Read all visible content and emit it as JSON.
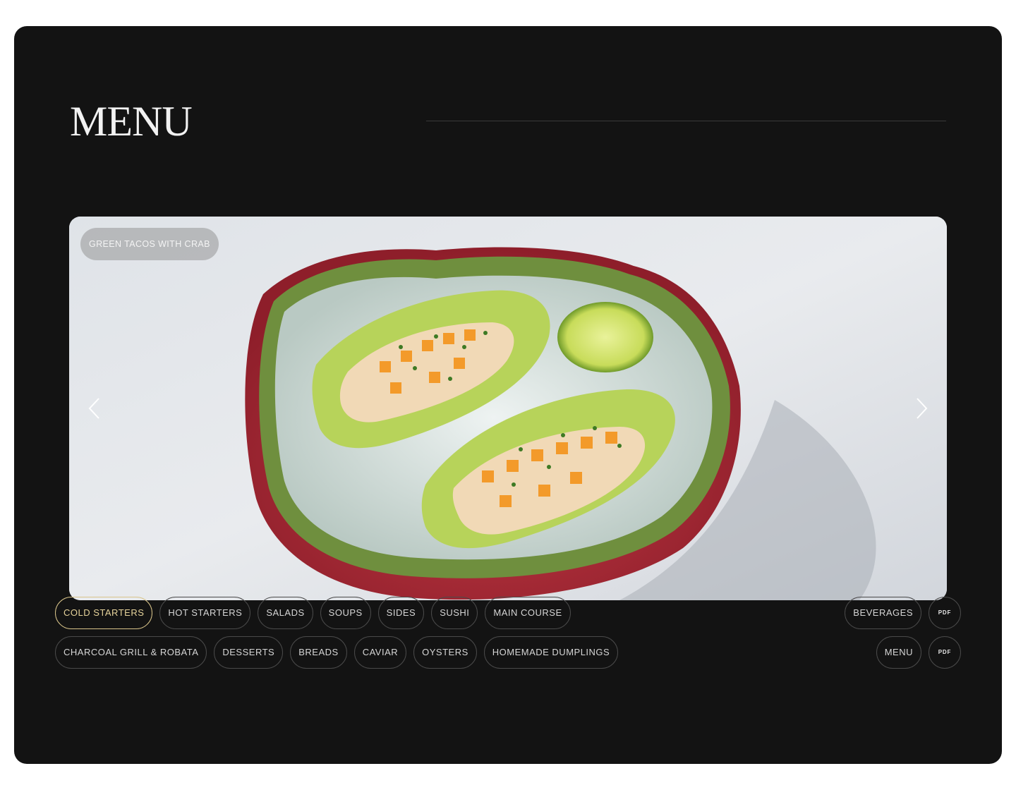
{
  "page": {
    "title": "MENU"
  },
  "hero": {
    "caption": "GREEN TACOS WITH CRAB",
    "prev_icon": "chevron-left-icon",
    "next_icon": "chevron-right-icon"
  },
  "categories": {
    "row1": [
      {
        "label": "COLD STARTERS",
        "active": true
      },
      {
        "label": "HOT STARTERS",
        "active": false
      },
      {
        "label": "SALADS",
        "active": false
      },
      {
        "label": "SOUPS",
        "active": false
      },
      {
        "label": "SIDES",
        "active": false
      },
      {
        "label": "SUSHI",
        "active": false
      },
      {
        "label": "MAIN COURSE",
        "active": false
      }
    ],
    "row2": [
      {
        "label": "CHARCOAL GRILL & ROBATA",
        "active": false
      },
      {
        "label": "DESSERTS",
        "active": false
      },
      {
        "label": "BREADS",
        "active": false
      },
      {
        "label": "CAVIAR",
        "active": false
      },
      {
        "label": "OYSTERS",
        "active": false
      },
      {
        "label": "HOMEMADE DUMPLINGS",
        "active": false
      }
    ]
  },
  "downloads": [
    {
      "label": "BEVERAGES",
      "pdf_label": "PDF"
    },
    {
      "label": "MENU",
      "pdf_label": "PDF"
    }
  ],
  "colors": {
    "panel": "#131313",
    "active_chip": "#d9c48a",
    "chip_border": "#4a4a4a"
  }
}
